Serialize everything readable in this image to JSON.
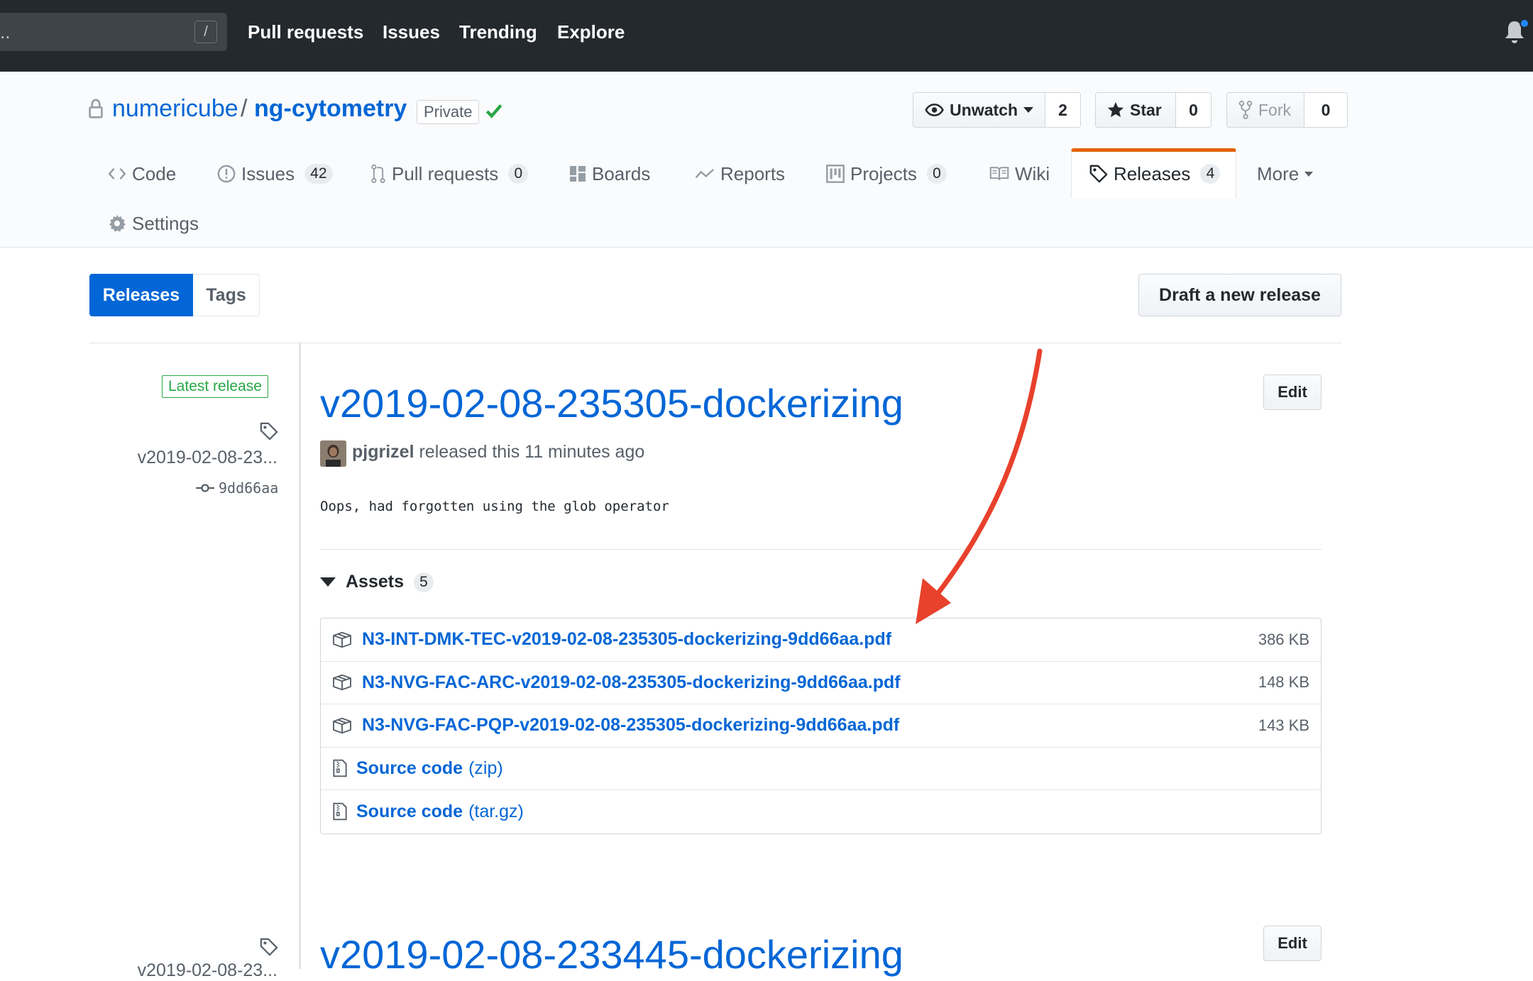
{
  "header": {
    "search_hint": "..",
    "search_shortcut": "/",
    "nav": [
      "Pull requests",
      "Issues",
      "Trending",
      "Explore"
    ],
    "notification_icon": "bell-icon",
    "notification_dot_color": "#2188ff"
  },
  "repo": {
    "owner": "numericube",
    "separator": "/",
    "name": "ng-cytometry",
    "visibility": "Private",
    "status_icon": "check-icon",
    "unwatch": {
      "label": "Unwatch",
      "count": "2"
    },
    "star": {
      "label": "Star",
      "count": "0"
    },
    "fork": {
      "label": "Fork",
      "count": "0"
    }
  },
  "tabs": [
    {
      "label": "Code",
      "icon": "code-icon"
    },
    {
      "label": "Issues",
      "count": "42",
      "icon": "issue-icon"
    },
    {
      "label": "Pull requests",
      "count": "0",
      "icon": "git-pull-request-icon"
    },
    {
      "label": "Boards",
      "icon": "boards-icon"
    },
    {
      "label": "Reports",
      "icon": "reports-icon"
    },
    {
      "label": "Projects",
      "count": "0",
      "icon": "project-icon"
    },
    {
      "label": "Wiki",
      "icon": "book-icon"
    },
    {
      "label": "Releases",
      "count": "4",
      "icon": "tag-icon",
      "selected": true
    },
    {
      "label": "More",
      "icon": "caret-down-icon"
    },
    {
      "label": "Settings",
      "icon": "gear-icon"
    }
  ],
  "subnav": {
    "releases": "Releases",
    "tags": "Tags",
    "draft": "Draft a new release"
  },
  "release1": {
    "latest_label": "Latest release",
    "tag": "v2019-02-08-23...",
    "commit": "9dd66aa",
    "title": "v2019-02-08-235305-dockerizing",
    "edit": "Edit",
    "author": "pjgrizel",
    "released_text": "released this 11 minutes ago",
    "body": "Oops, had forgotten using the glob operator",
    "assets_label": "Assets",
    "assets_count": "5",
    "assets": [
      {
        "name": "N3-INT-DMK-TEC-v2019-02-08-235305-dockerizing-9dd66aa.pdf",
        "size": "386 KB"
      },
      {
        "name": "N3-NVG-FAC-ARC-v2019-02-08-235305-dockerizing-9dd66aa.pdf",
        "size": "148 KB"
      },
      {
        "name": "N3-NVG-FAC-PQP-v2019-02-08-235305-dockerizing-9dd66aa.pdf",
        "size": "143 KB"
      }
    ],
    "sources": [
      {
        "label": "Source code",
        "ext": "(zip)"
      },
      {
        "label": "Source code",
        "ext": "(tar.gz)"
      }
    ]
  },
  "release2": {
    "title": "v2019-02-08-233445-dockerizing",
    "edit": "Edit",
    "tag": "v2019-02-08-23..."
  },
  "annotation": {
    "arrow_color": "#e8412c"
  },
  "colors": {
    "link": "#0366d6",
    "header_bg": "#24292e",
    "selected_tab_accent": "#e36209",
    "latest_green": "#28a745"
  }
}
